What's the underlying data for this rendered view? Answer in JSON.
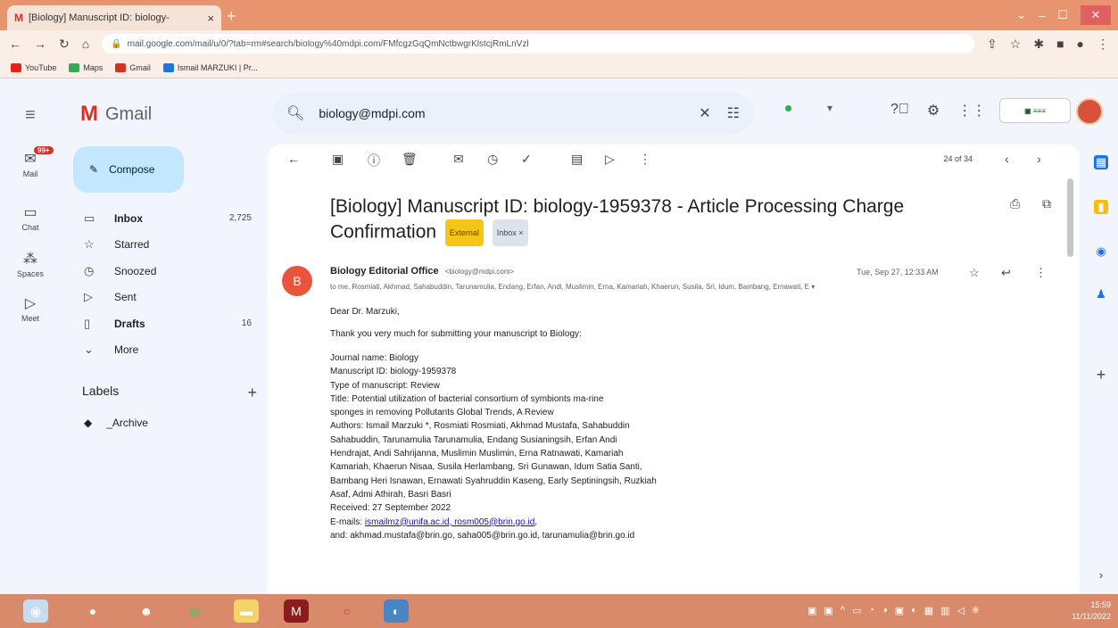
{
  "browser": {
    "tab_title": "[Biology] Manuscript ID: biology-",
    "tab_close": "×",
    "new_tab": "+",
    "url": "mail.google.com/mail/u/0/?tab=rm#search/biology%40mdpi.com/FMfcgzGqQmNctbwgrKlstcjRmLnVzl",
    "bookmarks": [
      "YouTube",
      "Maps",
      "Gmail",
      "Ismail MARZUKI | Pr..."
    ]
  },
  "header": {
    "app_name": "Gmail",
    "search_value": "biology@mdpi.com",
    "status_dropdown": "▾"
  },
  "rail": [
    {
      "label": "Mail",
      "badge": "99+"
    },
    {
      "label": "Chat"
    },
    {
      "label": "Spaces"
    },
    {
      "label": "Meet"
    }
  ],
  "compose_label": "Compose",
  "folders": [
    {
      "label": "Inbox",
      "count": "2,725",
      "bold": true
    },
    {
      "label": "Starred",
      "count": ""
    },
    {
      "label": "Snoozed",
      "count": ""
    },
    {
      "label": "Sent",
      "count": ""
    },
    {
      "label": "Drafts",
      "count": "16",
      "bold": true
    },
    {
      "label": "More",
      "count": ""
    }
  ],
  "labels_title": "Labels",
  "labels": [
    {
      "label": "_Archive"
    }
  ],
  "message": {
    "counter": "24 of 34",
    "subject_line1": "[Biology] Manuscript ID: biology-1959378 - Article Processing Charge",
    "subject_line2": "Confirmation",
    "chip_external": "External",
    "chip_inbox": "Inbox ×",
    "sender_initial": "B",
    "sender_name": "Biology Editorial Office",
    "sender_addr": "<biology@mdpi.com>",
    "date": "Tue, Sep 27, 12:33 AM",
    "recipients": "to me, Rosmiati, Akhmad, Sahabuddin, Tarunamulia, Endang, Erfan, Andi, Muslimin, Erna, Kamariah, Khaerun, Susila, Sri, Idum, Bambang, Ernawati, E ▾",
    "greeting": "Dear Dr. Marzuki,",
    "thanks": "Thank you very much for submitting your manuscript to Biology:",
    "lines": [
      "Journal name: Biology",
      "Manuscript ID: biology-1959378",
      "Type of manuscript: Review",
      "Title: Potential utilization of bacterial consortium of symbionts ma-rine",
      "sponges in removing Pollutants Global Trends, A Review",
      "Authors: Ismail Marzuki *, Rosmiati Rosmiati, Akhmad Mustafa, Sahabuddin",
      "Sahabuddin, Tarunamulia Tarunamulia, Endang Susianingsih, Erfan Andi",
      "Hendrajat, Andi Sahrijanna, Muslimin Muslimin, Erna Ratnawati, Kamariah",
      "Kamariah, Khaerun Nisaa, Susila Herlambang, Sri Gunawan, Idum Satia Santi,",
      "Bambang Heri Isnawan, Ernawati Syahruddin Kaseng, Early Septiningsih, Ruzkiah",
      "Asaf, Admi Athirah, Basri Basri",
      "Received: 27 September 2022"
    ],
    "emails_label": "E-mails:",
    "emails_links": "ismailmz@unifa.ac.id, rosm005@brin.go.id,",
    "emails_line2": "and: akhmad.mustafa@brin.go, saha005@brin.go.id, tarunamulia@brin.go.id"
  },
  "taskbar": {
    "time": "15:59",
    "date": "11/11/2022"
  },
  "colors": {
    "accent": "#c2e7ff",
    "chrome": "#e8956f",
    "taskbar": "#d88a6a"
  }
}
